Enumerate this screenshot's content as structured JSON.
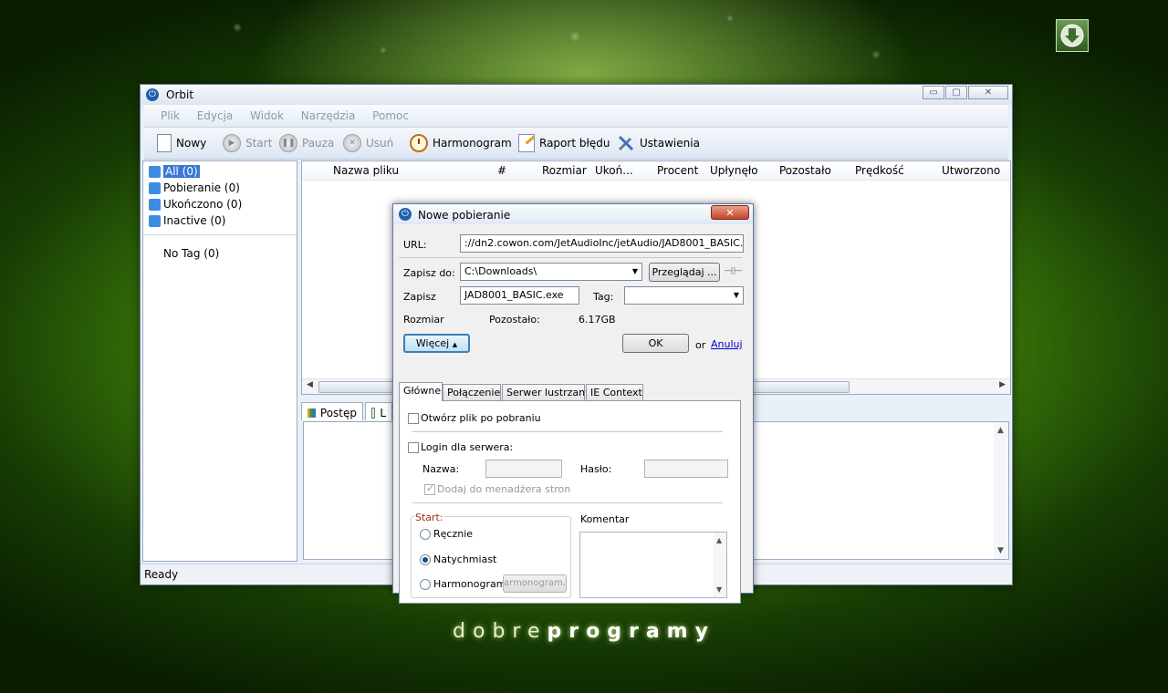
{
  "desktop": {
    "logo_light": "dobre",
    "logo_bold": "programy"
  },
  "window": {
    "title": "Orbit",
    "minimize": "▭",
    "maximize": "▢",
    "close": "✕"
  },
  "menu": [
    "Plik",
    "Edycja",
    "Widok",
    "Narzędzia",
    "Pomoc"
  ],
  "toolbar": {
    "new": "Nowy",
    "start": "Start",
    "pause": "Pauza",
    "delete": "Usuń",
    "schedule": "Harmonogram",
    "report": "Raport błędu",
    "settings": "Ustawienia"
  },
  "sidebar": {
    "items": [
      "All (0)",
      "Pobieranie (0)",
      "Ukończono (0)",
      "Inactive (0)"
    ],
    "tag": "No Tag (0)"
  },
  "list": {
    "columns": [
      "Nazwa pliku",
      "#",
      "Rozmiar",
      "Ukoń...",
      "Procent",
      "Upłynęło",
      "Pozostało",
      "Prędkość",
      "Utworzono"
    ]
  },
  "bottom_tabs": [
    "Postęp",
    "L"
  ],
  "status": "Ready",
  "dialog": {
    "title": "Nowe pobieranie",
    "close": "✕",
    "url_label": "URL:",
    "url_value": "://dn2.cowon.com/JetAudioInc/jetAudio/JAD8001_BASIC.exe",
    "saveto_label": "Zapisz do:",
    "saveto_value": "C:\\Downloads\\",
    "browse": "Przeglądaj ...",
    "savename_label": "Zapisz",
    "savename_value": "JAD8001_BASIC.exe",
    "tag_label": "Tag:",
    "tag_value": "",
    "size_label": "Rozmiar",
    "remaining_label": "Pozostało:",
    "remaining_value": "6.17GB",
    "more": "Więcej",
    "ok": "OK",
    "or": "or",
    "cancel": "Anuluj",
    "tabs": [
      "Główne",
      "Połączenie",
      "Serwer lustrzany",
      "IE Context"
    ],
    "open_after": "Otwórz plik po pobraniu",
    "login": "Login dla serwera:",
    "name_label": "Nazwa:",
    "pass_label": "Hasło:",
    "add_manager": "Dodaj do menadżera stron",
    "start_label": "Start:",
    "manual": "Ręcznie",
    "immediate": "Natychmiast",
    "schedule": "Harmonogram",
    "schedule_field": "armonogram...",
    "comment_label": "Komentar"
  }
}
